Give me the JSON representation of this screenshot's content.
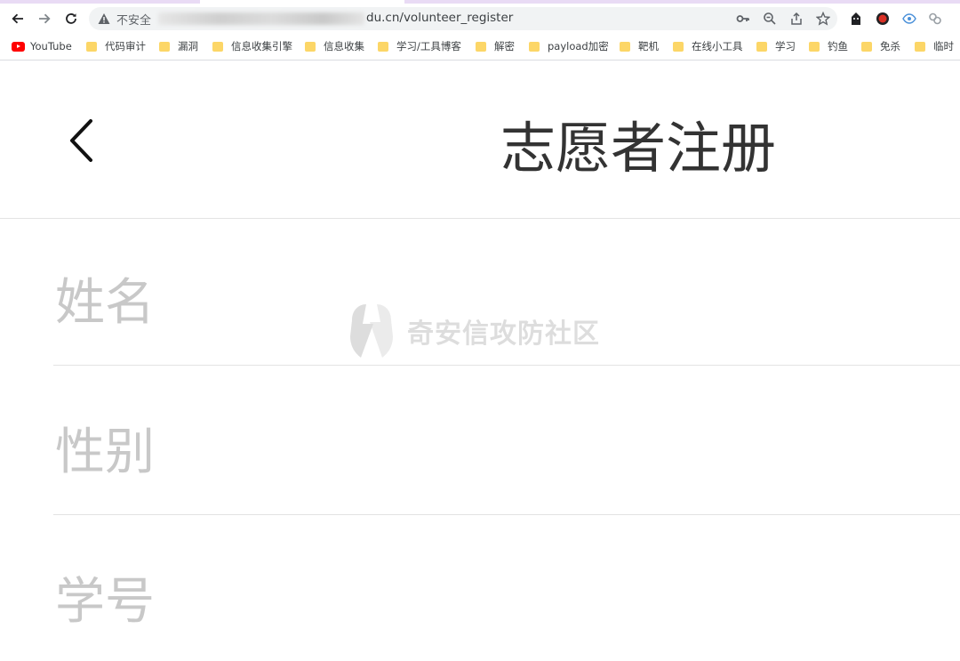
{
  "browser": {
    "security_label": "不安全",
    "url_tail": "du.cn/volunteer_register",
    "bookmarks": [
      "YouTube",
      "代码审计",
      "漏洞",
      "信息收集引擎",
      "信息收集",
      "学习/工具博客",
      "解密",
      "payload加密",
      "靶机",
      "在线小工具",
      "学习",
      "钓鱼",
      "免杀",
      "临时"
    ],
    "icons": {
      "back": "back-arrow-icon",
      "forward": "forward-arrow-icon",
      "reload": "reload-icon",
      "warning": "warning-icon",
      "key": "key-icon",
      "zoom": "zoom-icon",
      "share": "share-icon",
      "star": "star-icon"
    }
  },
  "page": {
    "title": "志愿者注册",
    "fields": [
      "姓名",
      "性别",
      "学号"
    ],
    "back_icon": "chevron-left-icon"
  },
  "watermark": {
    "text": "奇安信攻防社区"
  },
  "colors": {
    "accent_top": "#e9dbf5",
    "title": "#333333",
    "placeholder": "#c8c8c8",
    "divider": "#e3e3e3",
    "folder": "#fcd667",
    "youtube": "#ff0000"
  }
}
